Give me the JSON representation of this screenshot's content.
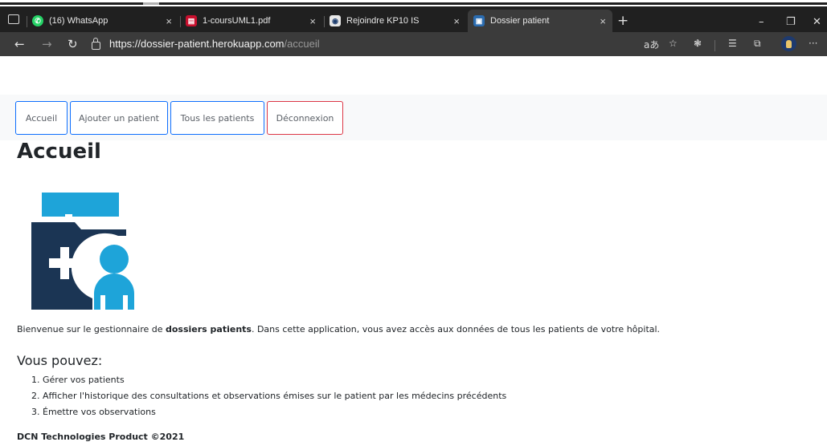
{
  "browser": {
    "tabs": [
      {
        "label": "(16) WhatsApp",
        "icon": "whatsapp-icon"
      },
      {
        "label": "1-coursUML1.pdf",
        "icon": "pdf-icon"
      },
      {
        "label": "Rejoindre KP10 IS",
        "icon": "meeting-icon"
      },
      {
        "label": "Dossier patient",
        "icon": "page-icon"
      }
    ],
    "url_host": "https://dossier-patient.herokuapp.com",
    "url_path": "/accueil"
  },
  "nav": {
    "items": [
      {
        "label": "Accueil"
      },
      {
        "label": "Ajouter un patient"
      },
      {
        "label": "Tous les patients"
      },
      {
        "label": "Déconnexion"
      }
    ]
  },
  "main": {
    "title": "Accueil",
    "intro_prefix": "Bienvenue sur le gestionnaire de ",
    "intro_bold": "dossiers patients",
    "intro_suffix": ". Dans cette application, vous avez accès aux données de tous les patients de votre hôpital.",
    "subtitle": "Vous pouvez:",
    "steps": [
      "Gérer vos patients",
      "Afficher l'historique des consultations et observations émises sur le patient par les médecins précédents",
      "Émettre vos observations"
    ],
    "step_numbers": [
      "1.",
      "2.",
      "3."
    ]
  },
  "footer": {
    "text": "DCN Technologies Product ©2021"
  },
  "colors": {
    "primary_border": "#0d6efd",
    "danger_border": "#dc3545",
    "logo_dark": "#1b3554",
    "logo_light": "#1ea4d9"
  }
}
